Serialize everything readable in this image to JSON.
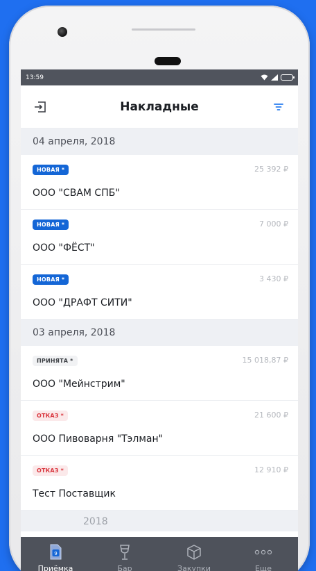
{
  "status": {
    "time": "13:59"
  },
  "header": {
    "title": "Накладные"
  },
  "sections": [
    {
      "date": "04 апреля, 2018",
      "items": [
        {
          "badge": "НОВАЯ *",
          "badge_type": "new",
          "amount": "25 392 ₽",
          "supplier": "ООО \"СВАМ СПБ\""
        },
        {
          "badge": "НОВАЯ *",
          "badge_type": "new",
          "amount": "7 000 ₽",
          "supplier": "ООО  \"ФЁСТ\""
        },
        {
          "badge": "НОВАЯ *",
          "badge_type": "new",
          "amount": "3 430 ₽",
          "supplier": "ООО \"ДРАФТ СИТИ\""
        }
      ]
    },
    {
      "date": "03 апреля, 2018",
      "items": [
        {
          "badge": "ПРИНЯТА *",
          "badge_type": "accepted",
          "amount": "15 018,87 ₽",
          "supplier": "ООО \"Мейнстрим\""
        },
        {
          "badge": "ОТКАЗ *",
          "badge_type": "refused",
          "amount": "21 600 ₽",
          "supplier": "ООО Пивоварня \"Тэлман\""
        },
        {
          "badge": "ОТКАЗ *",
          "badge_type": "refused",
          "amount": "12 910 ₽",
          "supplier": "Тест Поставщик"
        }
      ]
    }
  ],
  "partial_section": {
    "text": "2018"
  },
  "tabs": [
    {
      "label": "Приёмка",
      "icon": "invoice-icon",
      "active": true
    },
    {
      "label": "Бар",
      "icon": "glass-icon",
      "active": false
    },
    {
      "label": "Закупки",
      "icon": "box-icon",
      "active": false
    },
    {
      "label": "Еще",
      "icon": "more-icon",
      "active": false
    }
  ],
  "colors": {
    "accent": "#1466d6",
    "background": "#1f6ff0",
    "tabbar": "#4e525b"
  }
}
